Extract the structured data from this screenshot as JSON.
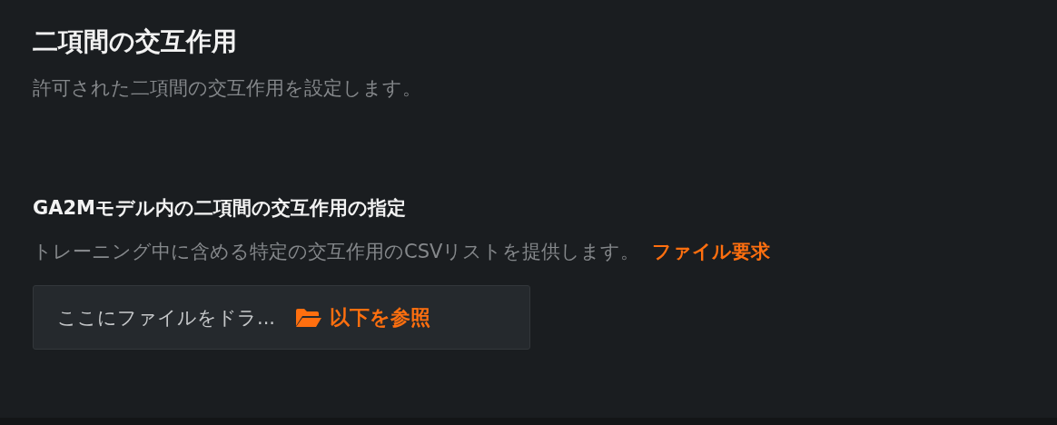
{
  "header": {
    "title": "二項間の交互作用",
    "subtitle": "許可された二項間の交互作用を設定します。"
  },
  "section": {
    "title": "GA2Mモデル内の二項間の交互作用の指定",
    "description": "トレーニング中に含める特定の交互作用のCSVリストを提供します。",
    "link": "ファイル要求"
  },
  "dropzone": {
    "placeholder": "ここにファイルをドラ...",
    "button": "以下を参照"
  }
}
